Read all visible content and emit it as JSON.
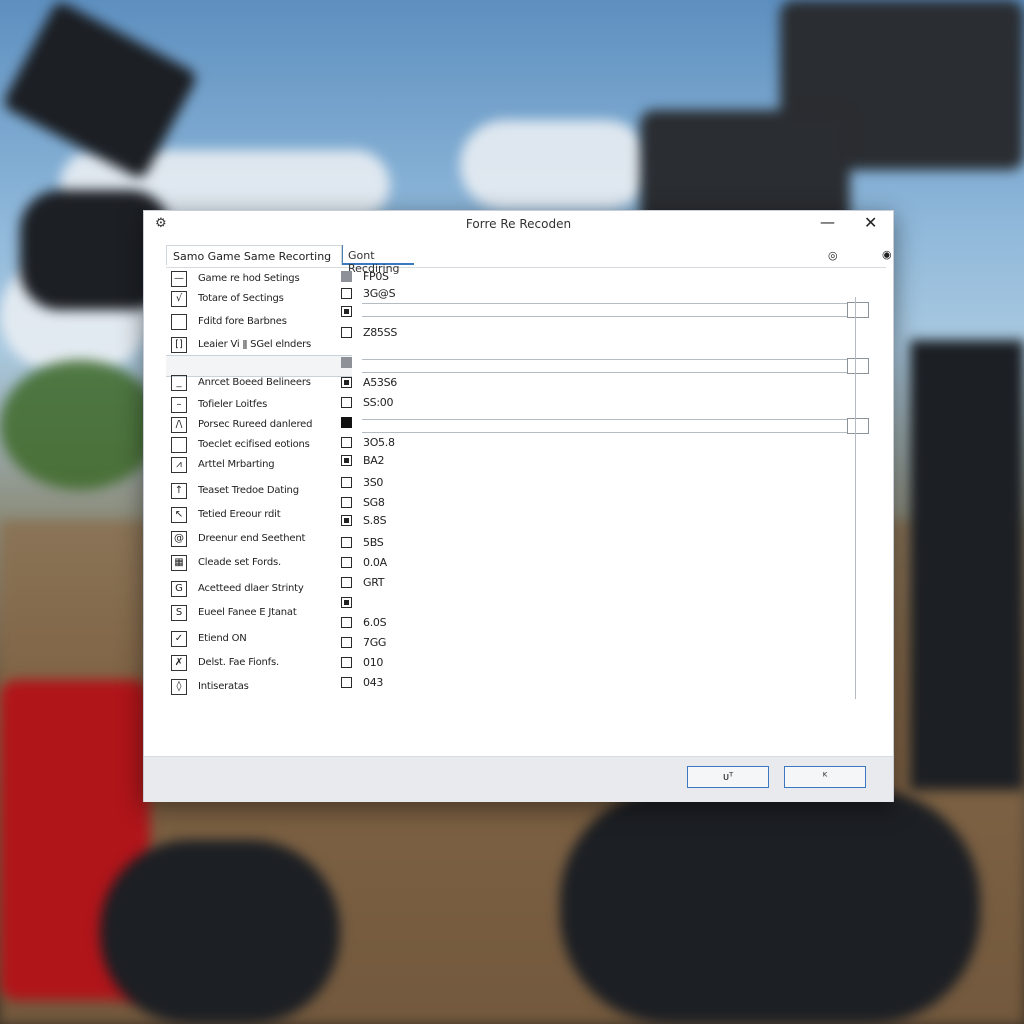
{
  "window": {
    "title": "Forre Re Recoden",
    "app_icon": "gear-icon",
    "minimize_glyph": "—",
    "close_glyph": "✕"
  },
  "tabs": [
    {
      "label": "Samo Game Same Recorting"
    },
    {
      "label": "Gont Recdiring"
    }
  ],
  "tab_icons": [
    "circle-settings-icon",
    "circle-icon"
  ],
  "sidebar": {
    "items": [
      {
        "label": "Game re hod Setings",
        "icon": "minus-box-icon",
        "glyph": "—"
      },
      {
        "label": "Totare of Sectings",
        "icon": "checkmark-box-icon",
        "glyph": "√"
      },
      {
        "label": "Fditd fore Barbnes",
        "icon": "empty-box-icon",
        "glyph": ""
      },
      {
        "label": "Leaier Vi ǁ SGel elnders",
        "icon": "bracket-box-icon",
        "glyph": "[]"
      },
      {
        "label": "Anrcet Boeed Belineers",
        "icon": "underline-box-icon",
        "glyph": "_"
      },
      {
        "label": "Tofieler Loitfes",
        "icon": "dash-box-icon",
        "glyph": "–"
      },
      {
        "label": "Porsec Rureed danlered",
        "icon": "slash-box-icon",
        "glyph": "/\\"
      },
      {
        "label": "Toeclet ecifised eotions",
        "icon": "empty-box-icon",
        "glyph": ""
      },
      {
        "label": "Arttel Mrbarting",
        "icon": "line-chart-box-icon",
        "glyph": "⩘"
      },
      {
        "label": "Teaset Tredoe Dating",
        "icon": "tick-box-icon",
        "glyph": "↑"
      },
      {
        "label": "Tetied Ereour rdit",
        "icon": "corner-box-icon",
        "glyph": "↖"
      },
      {
        "label": "Dreenur end Seethent",
        "icon": "spiral-box-icon",
        "glyph": "@"
      },
      {
        "label": "Cleade set Fords.",
        "icon": "grid-box-icon",
        "glyph": "▦"
      },
      {
        "label": "Acetteed dlaer Strinty",
        "icon": "g-box-icon",
        "glyph": "G"
      },
      {
        "label": "Eueel Fanee E Jtanat",
        "icon": "s-box-icon",
        "glyph": "S"
      },
      {
        "label": "Etiend ON",
        "icon": "check-box-icon",
        "glyph": "✓"
      },
      {
        "label": "Delst. Fae Fionfs.",
        "icon": "pen-box-icon",
        "glyph": "✗"
      },
      {
        "label": "Intiseratas",
        "icon": "circle-box-icon",
        "glyph": "◊"
      }
    ]
  },
  "values": [
    {
      "text": "FP0S",
      "state": "grey",
      "faded": false
    },
    {
      "text": "3G@S",
      "state": "empty",
      "faded": false
    },
    {
      "text": "",
      "state": "checked",
      "faded": false
    },
    {
      "text": "Z85SS",
      "state": "empty",
      "faded": false
    },
    {
      "text": "",
      "state": "grey",
      "faded": false
    },
    {
      "text": "A53S6",
      "state": "checked",
      "faded": false
    },
    {
      "text": "SS:00",
      "state": "empty",
      "faded": false
    },
    {
      "text": "",
      "state": "black",
      "faded": false
    },
    {
      "text": "3O5.8",
      "state": "empty",
      "faded": false
    },
    {
      "text": "BA2",
      "state": "checked",
      "faded": false
    },
    {
      "text": "3S0",
      "state": "empty",
      "faded": false
    },
    {
      "text": "SG8",
      "state": "empty",
      "faded": false
    },
    {
      "text": "S.8S",
      "state": "checked",
      "faded": false
    },
    {
      "text": "5BS",
      "state": "empty",
      "faded": false
    },
    {
      "text": "0.0A",
      "state": "empty",
      "faded": false
    },
    {
      "text": "GRT",
      "state": "empty",
      "faded": false
    },
    {
      "text": "",
      "state": "checked",
      "faded": true
    },
    {
      "text": "6.0S",
      "state": "empty",
      "faded": false
    },
    {
      "text": "7GG",
      "state": "empty",
      "faded": false
    },
    {
      "text": "010",
      "state": "empty",
      "faded": false
    },
    {
      "text": "043",
      "state": "empty",
      "faded": false
    }
  ],
  "sliders": [
    {
      "name": "slider-1",
      "level": 0.98
    },
    {
      "name": "slider-2",
      "level": 0.98
    },
    {
      "name": "slider-3",
      "level": 0.98
    }
  ],
  "footer": {
    "ok_label": "ᴜᵀ",
    "cancel_label": "ᴷ"
  }
}
